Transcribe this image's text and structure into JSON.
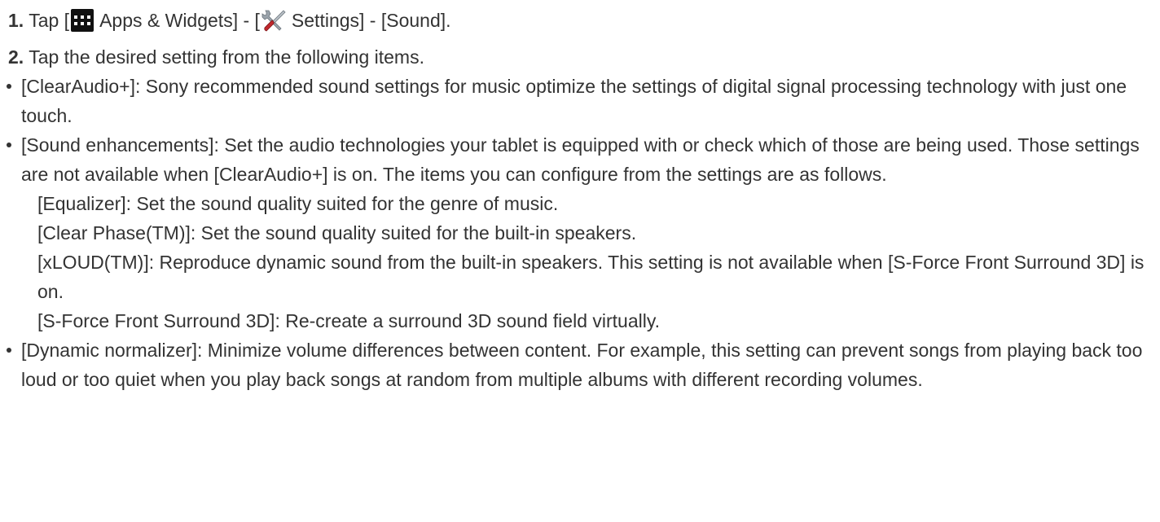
{
  "steps": [
    {
      "number": "1.",
      "tap": "Tap [",
      "apps_label": "Apps & Widgets] - [",
      "settings_label": "Settings] - [Sound].",
      "icons": [
        "apps-grid-icon",
        "settings-tools-icon"
      ]
    },
    {
      "number": "2.",
      "text": "Tap the desired setting from the following items."
    }
  ],
  "items": [
    {
      "text": "[ClearAudio+]: Sony recommended sound settings for music optimize the settings of digital signal processing technology with just one touch."
    },
    {
      "text": "[Sound enhancements]: Set the audio technologies your tablet is equipped with or check which of those are being used. Those settings are not available when [ClearAudio+] is on. The items you can configure from the settings are as follows.",
      "sub_items": [
        "[Equalizer]: Set the sound quality suited for the genre of music.",
        "[Clear Phase(TM)]: Set the sound quality suited for the built-in speakers.",
        "[xLOUD(TM)]: Reproduce dynamic sound from the built-in speakers. This setting is not available when [S-Force Front Surround 3D] is on.",
        "[S-Force Front Surround 3D]: Re-create a surround 3D sound field virtually."
      ]
    },
    {
      "text": "[Dynamic normalizer]: Minimize volume differences between content. For example, this setting can prevent songs from playing back too loud or too quiet when you play back songs at random from multiple albums with different recording volumes."
    }
  ],
  "colors": {
    "text": "#333333",
    "apps_icon_bg": "#111111",
    "settings_icon_red": "#c0282d",
    "settings_icon_gray": "#9aa3ab"
  }
}
